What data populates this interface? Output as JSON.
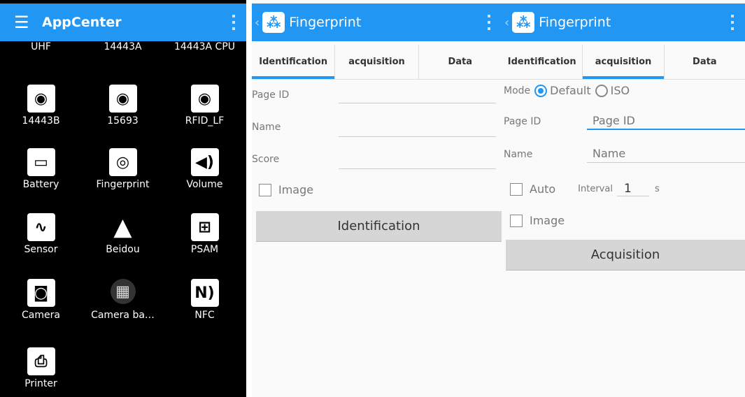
{
  "appcenter": {
    "title": "AppCenter",
    "top_labels": [
      "UHF",
      "14443A",
      "14443A CPU"
    ],
    "apps": [
      {
        "label": "14443B",
        "icon": "rfid-card-icon"
      },
      {
        "label": "15693",
        "icon": "rfid-card-icon"
      },
      {
        "label": "RFID_LF",
        "icon": "rfid-card-icon"
      },
      {
        "label": "Battery",
        "icon": "battery-icon"
      },
      {
        "label": "Fingerprint",
        "icon": "fingerprint-icon"
      },
      {
        "label": "Volume",
        "icon": "volume-icon"
      },
      {
        "label": "Sensor",
        "icon": "sensor-icon"
      },
      {
        "label": "Beidou",
        "icon": "navigation-arrow-icon"
      },
      {
        "label": "PSAM",
        "icon": "psam-card-icon"
      },
      {
        "label": "Camera",
        "icon": "camera-icon"
      },
      {
        "label": "Camera ba…",
        "icon": "qr-code-icon"
      },
      {
        "label": "NFC",
        "icon": "nfc-icon"
      },
      {
        "label": "Printer",
        "icon": "printer-icon"
      }
    ]
  },
  "fp_ident": {
    "title": "Fingerprint",
    "tabs": [
      "Identification",
      "acquisition",
      "Data"
    ],
    "active_tab": 0,
    "page_id_label": "Page ID",
    "name_label": "Name",
    "score_label": "Score",
    "image_label": "Image",
    "button": "Identification"
  },
  "fp_acq": {
    "title": "Fingerprint",
    "tabs": [
      "Identification",
      "acquisition",
      "Data"
    ],
    "active_tab": 1,
    "mode_label": "Mode",
    "mode_default": "Default",
    "mode_iso": "ISO",
    "page_id_label": "Page ID",
    "page_id_placeholder": "Page ID",
    "name_label": "Name",
    "name_placeholder": "Name",
    "auto_label": "Auto",
    "interval_label": "Interval",
    "interval_value": "1",
    "interval_unit": "s",
    "image_label": "Image",
    "button": "Acquisition"
  },
  "colors": {
    "accent": "#2196f3"
  }
}
